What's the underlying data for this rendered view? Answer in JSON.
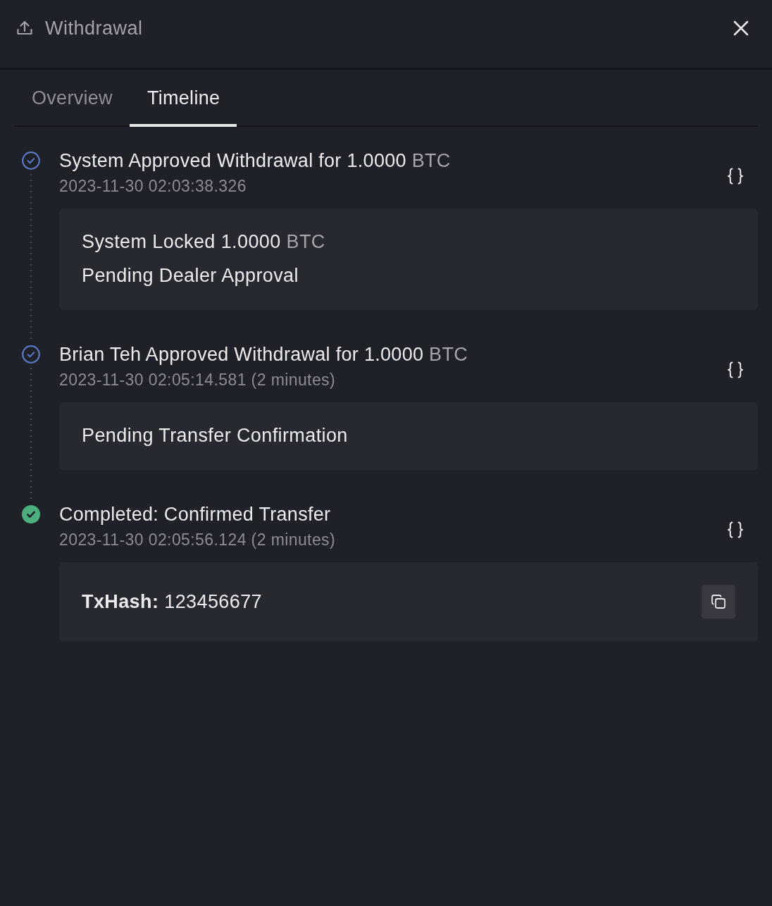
{
  "header": {
    "title": "Withdrawal"
  },
  "tabs": [
    {
      "label": "Overview",
      "selected": false
    },
    {
      "label": "Timeline",
      "selected": true
    }
  ],
  "timeline": [
    {
      "completed": false,
      "title": "System Approved Withdrawal for 1.0000",
      "unit": "BTC",
      "timestamp": "2023-11-30 02:03:38.326",
      "details": [
        {
          "kind": "text",
          "text": "System Locked 1.0000",
          "unit": "BTC"
        },
        {
          "kind": "text",
          "text": "Pending Dealer Approval"
        }
      ]
    },
    {
      "completed": false,
      "title": "Brian Teh Approved Withdrawal for 1.0000",
      "unit": "BTC",
      "timestamp": "2023-11-30 02:05:14.581 (2 minutes)",
      "details": [
        {
          "kind": "text",
          "text": "Pending Transfer Confirmation"
        }
      ]
    },
    {
      "completed": true,
      "title": "Completed: Confirmed Transfer",
      "timestamp": "2023-11-30 02:05:56.124 (2 minutes)",
      "details": [
        {
          "kind": "hash",
          "label": "TxHash:",
          "value": "123456677"
        }
      ]
    }
  ]
}
